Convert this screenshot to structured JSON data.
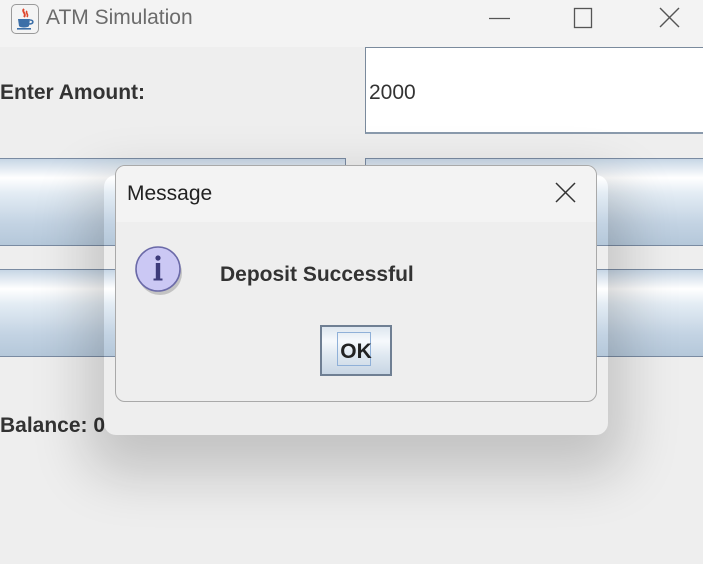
{
  "window": {
    "title": "ATM Simulation",
    "icon": "java-cup-icon",
    "controls": [
      "minimize-icon",
      "maximize-icon",
      "close-icon"
    ]
  },
  "form": {
    "amount_label": "Enter Amount:",
    "amount_value": "2000",
    "balance_label": "Balance: 0"
  },
  "dialog": {
    "title": "Message",
    "icon": "info-icon",
    "message": "Deposit Successful",
    "ok_label": "OK",
    "close_icon": "close-icon"
  },
  "colors": {
    "button_gradient_top": "#ffffff",
    "button_gradient_bottom": "#b5c8da",
    "info_icon_fill": "#c9c6f2",
    "background": "#eeeeee"
  }
}
